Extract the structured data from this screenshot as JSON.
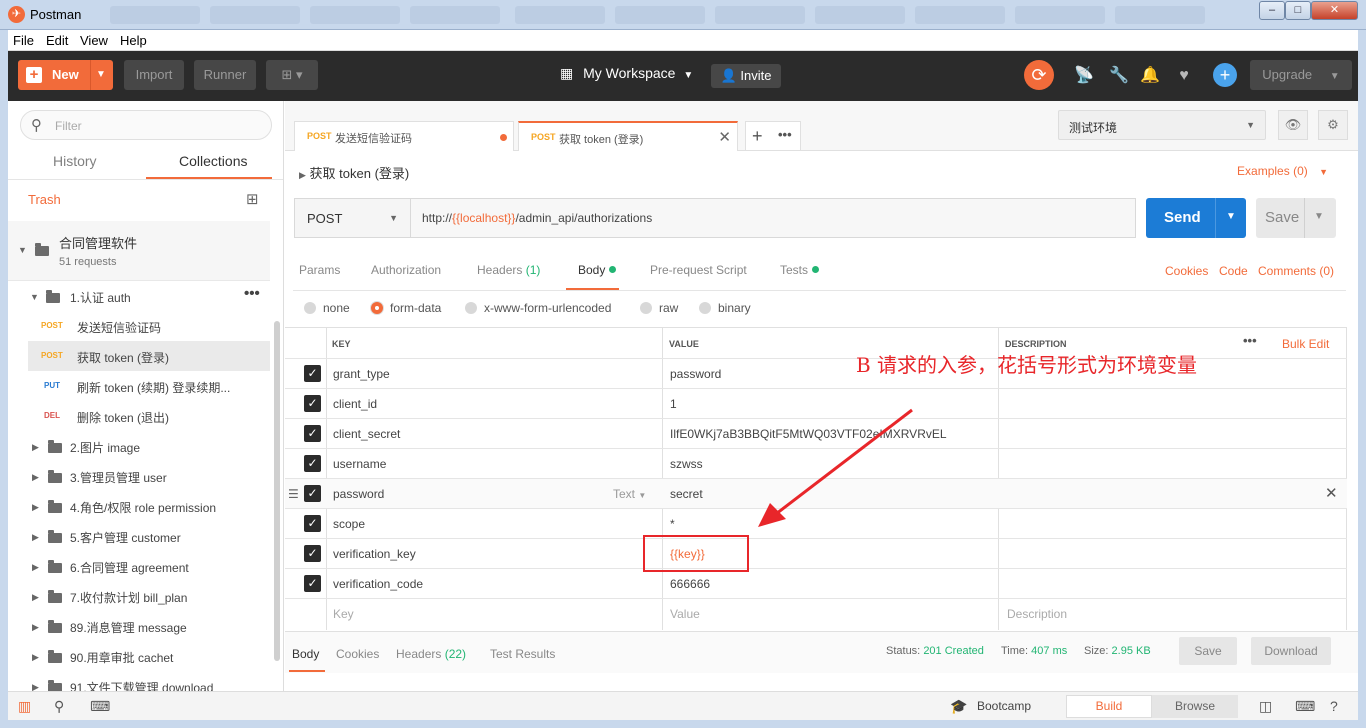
{
  "window": {
    "title": "Postman",
    "minimize": "–",
    "maximize": "□",
    "close": "✕"
  },
  "menu": [
    "File",
    "Edit",
    "View",
    "Help"
  ],
  "toolbar": {
    "new_label": "New",
    "import_label": "Import",
    "runner_label": "Runner",
    "workspace_label": "My Workspace",
    "invite_label": "Invite",
    "upgrade_label": "Upgrade"
  },
  "sidebar": {
    "filter_placeholder": "Filter",
    "tabs": [
      "History",
      "Collections"
    ],
    "trash_label": "Trash",
    "collection": {
      "name": "合同管理软件",
      "count": "51 requests"
    },
    "folder": "1.认证 auth",
    "requests": [
      {
        "method": "POST",
        "name": "发送短信验证码"
      },
      {
        "method": "POST",
        "name": "获取 token (登录)"
      },
      {
        "method": "PUT",
        "name": "刷新 token (续期) 登录续期..."
      },
      {
        "method": "DEL",
        "name": "删除 token (退出)"
      }
    ],
    "folders": [
      "2.图片 image",
      "3.管理员管理 user",
      "4.角色/权限 role permission",
      "5.客户管理 customer",
      "6.合同管理 agreement",
      "7.收付款计划 bill_plan",
      "89.消息管理 message",
      "90.用章审批 cachet",
      "91.文件下载管理 download"
    ]
  },
  "request_tabs": [
    {
      "method": "POST",
      "name": "发送短信验证码"
    },
    {
      "method": "POST",
      "name": "获取 token (登录)"
    }
  ],
  "environment": "测试环境",
  "request": {
    "title": "获取 token (登录)",
    "examples": "Examples (0)",
    "method": "POST",
    "url_prefix": "http://",
    "url_var": "{{localhost}}",
    "url_suffix": "/admin_api/authorizations",
    "send_label": "Send",
    "save_label": "Save"
  },
  "req_tabs": {
    "params": "Params",
    "authorization": "Authorization",
    "headers": "Headers",
    "headers_count": "(1)",
    "body": "Body",
    "prerequest": "Pre-request Script",
    "tests": "Tests",
    "cookies": "Cookies",
    "code": "Code",
    "comments": "Comments (0)"
  },
  "body_modes": [
    "none",
    "form-data",
    "x-www-form-urlencoded",
    "raw",
    "binary"
  ],
  "table": {
    "headers": [
      "KEY",
      "VALUE",
      "DESCRIPTION"
    ],
    "bulk_edit": "Bulk Edit",
    "rows": [
      {
        "key": "grant_type",
        "value": "password"
      },
      {
        "key": "client_id",
        "value": "1"
      },
      {
        "key": "client_secret",
        "value": "IlfE0WKj7aB3BBQitF5MtWQ03VTF02eIMXRVRvEL"
      },
      {
        "key": "username",
        "value": "szwss"
      },
      {
        "key": "password",
        "value": "secret"
      },
      {
        "key": "scope",
        "value": "*"
      },
      {
        "key": "verification_key",
        "value": "{{key}}"
      },
      {
        "key": "verification_code",
        "value": "666666"
      }
    ],
    "placeholder_key": "Key",
    "placeholder_value": "Value",
    "placeholder_desc": "Description",
    "type_label": "Text"
  },
  "response": {
    "tabs": {
      "body": "Body",
      "cookies": "Cookies",
      "headers": "Headers",
      "headers_count": "(22)",
      "tests": "Test Results"
    },
    "status_label": "Status:",
    "status": "201 Created",
    "time_label": "Time:",
    "time": "407 ms",
    "size_label": "Size:",
    "size": "2.95 KB",
    "save_label": "Save",
    "download_label": "Download"
  },
  "annotation": "B 请求的入参，花括号形式为环境变量",
  "statusbar": {
    "bootcamp": "Bootcamp",
    "build": "Build",
    "browse": "Browse"
  },
  "colors": {
    "accent": "#f26b3a",
    "send": "#1c7cd6",
    "annotation": "#e8262a",
    "success": "#22b573"
  }
}
